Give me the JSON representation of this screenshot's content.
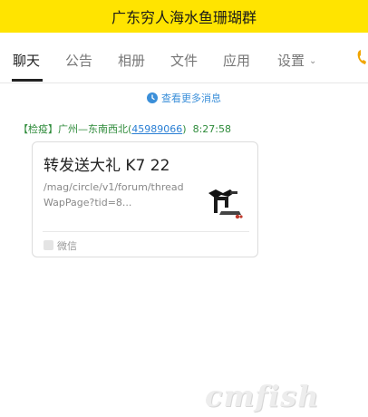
{
  "title": "广东穷人海水鱼珊瑚群",
  "tabs": [
    {
      "label": "聊天"
    },
    {
      "label": "公告"
    },
    {
      "label": "相册"
    },
    {
      "label": "文件"
    },
    {
      "label": "应用"
    },
    {
      "label": "设置"
    }
  ],
  "active_tab": "聊天",
  "more_messages": "查看更多消息",
  "message": {
    "sender_prefix": "【检疫】广州—东南西北",
    "paren_open": "(",
    "uid": "45989066",
    "paren_close": ")",
    "time": "8:27:58",
    "card": {
      "title": "转发送大礼 K7 22",
      "desc": "/mag/circle/v1/forum/threadWapPage?tid=8...",
      "source": "微信"
    }
  },
  "watermark": "cmfish",
  "colors": {
    "title_bar": "#ffe400",
    "sender": "#2e8b3a",
    "link": "#3b8fd9"
  }
}
